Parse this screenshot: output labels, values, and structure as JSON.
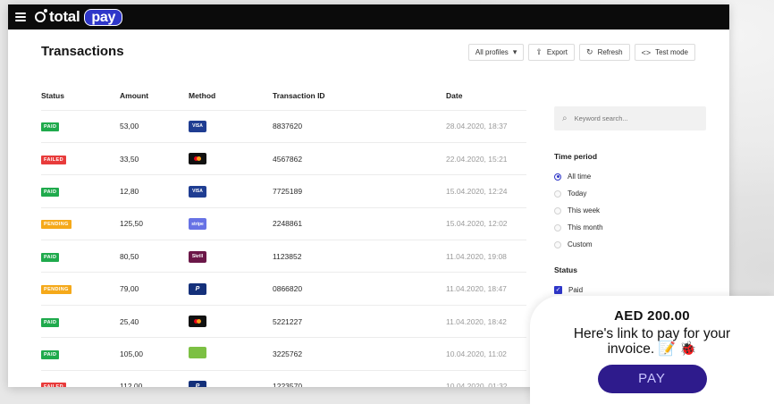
{
  "app": {
    "logo_total": "total",
    "logo_pay": "pay"
  },
  "page": {
    "title": "Transactions"
  },
  "toolbar": {
    "profiles_label": "All profiles",
    "export_label": "Export",
    "refresh_label": "Refresh",
    "testmode_label": "Test mode"
  },
  "table": {
    "headers": {
      "status": "Status",
      "amount": "Amount",
      "method": "Method",
      "id": "Transaction ID",
      "date": "Date"
    },
    "rows": [
      {
        "status": "PAID",
        "status_kind": "paid",
        "amount": "53,00",
        "method": "visa",
        "method_label": "VISA",
        "id": "8837620",
        "date": "28.04.2020, 18:37"
      },
      {
        "status": "FAILED",
        "status_kind": "failed",
        "amount": "33,50",
        "method": "mastercard",
        "method_label": "",
        "id": "4567862",
        "date": "22.04.2020, 15:21"
      },
      {
        "status": "PAID",
        "status_kind": "paid",
        "amount": "12,80",
        "method": "visa",
        "method_label": "VISA",
        "id": "7725189",
        "date": "15.04.2020, 12:24"
      },
      {
        "status": "PENDING",
        "status_kind": "pending",
        "amount": "125,50",
        "method": "stripe",
        "method_label": "stripe",
        "id": "2248861",
        "date": "15.04.2020, 12:02"
      },
      {
        "status": "PAID",
        "status_kind": "paid",
        "amount": "80,50",
        "method": "skrill",
        "method_label": "Skrill",
        "id": "1123852",
        "date": "11.04.2020, 19:08"
      },
      {
        "status": "PENDING",
        "status_kind": "pending",
        "amount": "79,00",
        "method": "paypal",
        "method_label": "P",
        "id": "0866820",
        "date": "11.04.2020, 18:47"
      },
      {
        "status": "PAID",
        "status_kind": "paid",
        "amount": "25,40",
        "method": "mastercard",
        "method_label": "",
        "id": "5221227",
        "date": "11.04.2020, 18:42"
      },
      {
        "status": "PAID",
        "status_kind": "paid",
        "amount": "105,00",
        "method": "green",
        "method_label": "",
        "id": "3225762",
        "date": "10.04.2020, 11:02"
      },
      {
        "status": "FAILED",
        "status_kind": "failed",
        "amount": "112,00",
        "method": "paypal",
        "method_label": "P",
        "id": "1223570",
        "date": "10.04.2020, 01:32"
      }
    ]
  },
  "sidebar": {
    "search_placeholder": "Keyword search...",
    "time_period_title": "Time period",
    "time_options": [
      "All time",
      "Today",
      "This week",
      "This month",
      "Custom"
    ],
    "time_selected": 0,
    "status_title": "Status",
    "status_options": [
      "Paid"
    ]
  },
  "invoice": {
    "amount": "AED 200.00",
    "text": "Here's link to pay for your invoice. 📝 🐞",
    "pay_label": "PAY"
  },
  "colors": {
    "accent": "#2f37c9",
    "paid": "#1faa4c",
    "failed": "#e83b3b",
    "pending": "#f5a91a",
    "pay_button": "#2e1b8c"
  }
}
